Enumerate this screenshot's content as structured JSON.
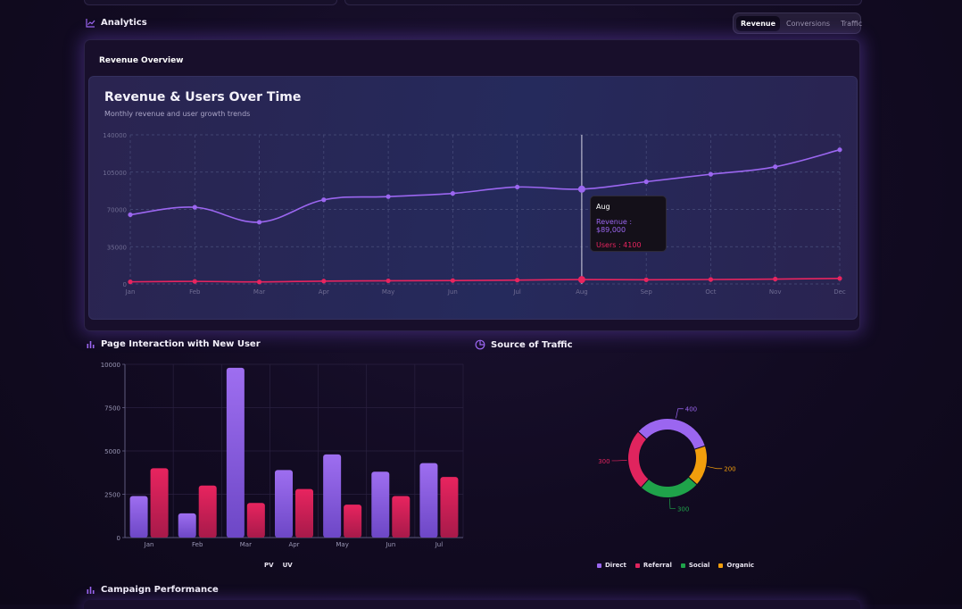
{
  "analytics": {
    "title": "Analytics",
    "tabs": [
      {
        "label": "Revenue",
        "active": true
      },
      {
        "label": "Conversions",
        "active": false
      },
      {
        "label": "Traffic",
        "active": false
      }
    ]
  },
  "revenue_panel": {
    "header": "Revenue Overview",
    "chart_title": "Revenue & Users Over Time",
    "chart_subtitle": "Monthly revenue and user growth trends"
  },
  "tooltip": {
    "month": "Aug",
    "revenue_text": "Revenue : $89,000",
    "users_text": "Users : 4100"
  },
  "page_interaction": {
    "title": "Page Interaction with New User"
  },
  "traffic": {
    "title": "Source of Traffic"
  },
  "campaign": {
    "title": "Campaign Performance"
  },
  "colors": {
    "revenue": "#9b66f0",
    "users": "#e8245f",
    "direct": "#9b66f0",
    "referral": "#e0245e",
    "social": "#1fa34a",
    "organic": "#f29e0c"
  },
  "chart_data": [
    {
      "type": "line",
      "categories": [
        "Jan",
        "Feb",
        "Mar",
        "Apr",
        "May",
        "Jun",
        "Jul",
        "Aug",
        "Sep",
        "Oct",
        "Nov",
        "Dec"
      ],
      "series": [
        {
          "values": [
            65000,
            72000,
            58000,
            79000,
            82000,
            85000,
            91000,
            89000,
            96000,
            103000,
            110000,
            126000
          ]
        },
        {
          "values": [
            2000,
            2400,
            1900,
            2700,
            3000,
            3200,
            3600,
            4100,
            3900,
            4200,
            4600,
            5200
          ]
        }
      ],
      "yticks": [
        "0",
        "35000",
        "70000",
        "105000",
        "140000"
      ],
      "ylim": [
        0,
        140000
      ],
      "grid": true,
      "highlight_index": 7
    },
    {
      "type": "bar",
      "categories": [
        "Jan",
        "Feb",
        "Mar",
        "Apr",
        "May",
        "Jun",
        "Jul"
      ],
      "series": [
        {
          "name": "PV",
          "values": [
            2400,
            1400,
            9800,
            3900,
            4800,
            3800,
            4300
          ]
        },
        {
          "name": "UV",
          "values": [
            4000,
            3000,
            2000,
            2800,
            1900,
            2400,
            3500
          ]
        }
      ],
      "yticks": [
        "0",
        "2500",
        "5000",
        "7500",
        "10000"
      ],
      "ylim": [
        0,
        10000
      ],
      "grid": true,
      "legend": "bottom"
    },
    {
      "type": "pie",
      "categories": [
        "Direct",
        "Referral",
        "Social",
        "Organic"
      ],
      "values": [
        400,
        300,
        300,
        200
      ],
      "value_labels": [
        "400",
        "300",
        "300",
        "200"
      ],
      "legend": "bottom"
    }
  ]
}
